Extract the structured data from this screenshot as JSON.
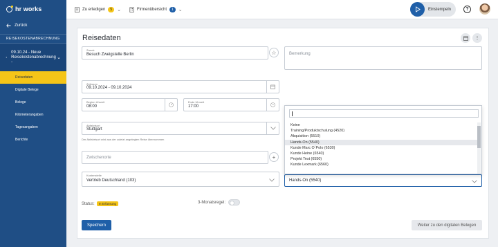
{
  "brand": {
    "name": "hr works"
  },
  "sidebar": {
    "back_label": "Zurück",
    "section_title": "REISEKOSTENABRECHNUNG",
    "current_item": "09.10.24 - Neue Reisekostenabrechnung -",
    "items": [
      {
        "label": "Reisedaten",
        "active": true
      },
      {
        "label": "Digitale Belege",
        "active": false
      },
      {
        "label": "Belege",
        "active": false
      },
      {
        "label": "Kilometerangaben",
        "active": false
      },
      {
        "label": "Tagesangaben",
        "active": false
      },
      {
        "label": "Berichte",
        "active": false
      }
    ]
  },
  "topbar": {
    "todo_label": "Zu erledigen",
    "todo_count": "5",
    "company_label": "Firmenübersicht",
    "company_count": "1",
    "clock_in_label": "Einstempeln",
    "help_glyph": "?"
  },
  "form": {
    "title": "Reisedaten",
    "zweck_label": "Zweck",
    "zweck_value": "Besuch Zweigstelle Berlin",
    "bemerkung_placeholder": "Bemerkung",
    "zeitraum_label": "Zeitraum",
    "zeitraum_value": "09.10.2024 - 09.10.2024",
    "beginn_label": "Beginn Uhrzeit",
    "beginn_value": "08:00",
    "ende_label": "Ende Uhrzeit",
    "ende_value": "17:00",
    "abfahrtsort_label": "Abfahrtsort",
    "abfahrtsort_value": "Stuttgart",
    "abfahrtsort_hint": "Der Abfahrtsort wird aus der zuletzt angelegten Reise übernommen",
    "zwischenorte_placeholder": "Zwischenorte",
    "kostenstelle_label": "Kostenstelle",
    "kostenstelle_value": "Vertrieb Deutschland (103)",
    "kostentraeger_value": "Hands-On (5540)",
    "status_label": "Status:",
    "status_value": "In Erfassung",
    "three_month_label": "3-Monatsregel:",
    "save_label": "Speichern",
    "next_label": "Weiter zu den digitalen Belegen"
  },
  "dropdown": {
    "options": [
      "Keine",
      "Training/Produktschulung (4520)",
      "Akquisition (5510)",
      "Hands-On (5540)",
      "Kunde Marc O´Polo (6530)",
      "Kunde Heine (6540)",
      "Projekt Test (6550)",
      "Kunde Lexmark (6560)"
    ],
    "highlighted_index": 3
  },
  "colors": {
    "sidebar_bg": "#1f4e85",
    "accent_yellow": "#f5c518",
    "primary_blue": "#1f5fa8"
  }
}
